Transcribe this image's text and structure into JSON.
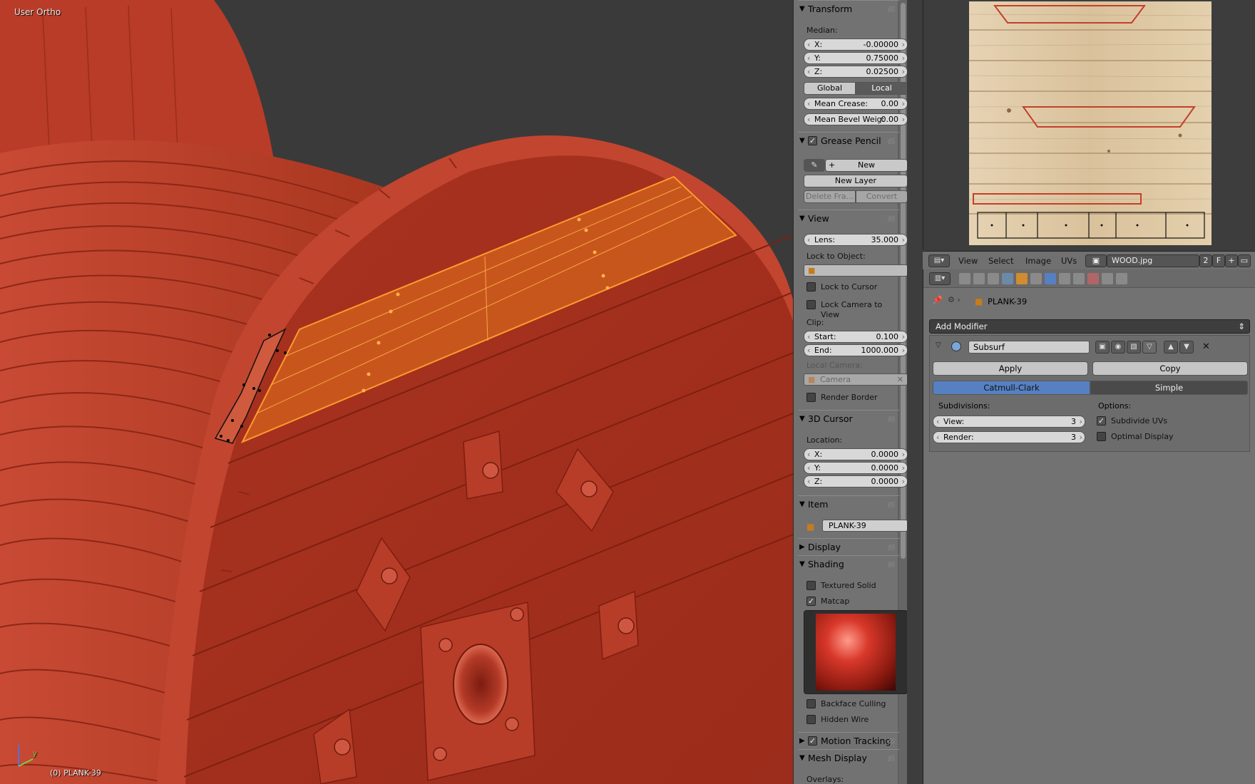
{
  "viewport": {
    "view_label": "User Ortho",
    "object_label": "(0) PLANK-39",
    "axis_label_y": "y"
  },
  "npanel": {
    "transform": {
      "title": "Transform",
      "median_label": "Median:",
      "x_label": "X:",
      "x_value": "-0.00000",
      "y_label": "Y:",
      "y_value": "0.75000",
      "z_label": "Z:",
      "z_value": "0.02500",
      "global_label": "Global",
      "local_label": "Local",
      "crease_label": "Mean Crease:",
      "crease_value": "0.00",
      "bevel_label": "Mean Bevel Weig:",
      "bevel_value": "0.00"
    },
    "grease_pencil": {
      "title": "Grease Pencil",
      "new_label": "New",
      "new_layer_label": "New Layer",
      "delete_label": "Delete Fra...",
      "convert_label": "Convert"
    },
    "view": {
      "title": "View",
      "lens_label": "Lens:",
      "lens_value": "35.000",
      "lock_object_label": "Lock to Object:",
      "lock_cursor_label": "Lock to Cursor",
      "lock_camera_label": "Lock Camera to View",
      "clip_label": "Clip:",
      "start_label": "Start:",
      "start_value": "0.100",
      "end_label": "End:",
      "end_value": "1000.000",
      "local_camera_label": "Local Camera:",
      "camera_value": "Camera",
      "render_border_label": "Render Border"
    },
    "cursor": {
      "title": "3D Cursor",
      "location_label": "Location:",
      "x_label": "X:",
      "x_value": "0.0000",
      "y_label": "Y:",
      "y_value": "0.0000",
      "z_label": "Z:",
      "z_value": "0.0000"
    },
    "item": {
      "title": "Item",
      "name_value": "PLANK-39"
    },
    "display": {
      "title": "Display"
    },
    "shading": {
      "title": "Shading",
      "textured_solid_label": "Textured Solid",
      "matcap_label": "Matcap",
      "backface_label": "Backface Culling",
      "hidden_wire_label": "Hidden Wire"
    },
    "motion_tracking": {
      "title": "Motion Tracking"
    },
    "mesh_display": {
      "title": "Mesh Display",
      "overlays_label": "Overlays:"
    }
  },
  "image_editor": {
    "menu": [
      "View",
      "Select",
      "Image",
      "UVs"
    ],
    "image_name": "WOOD.jpg",
    "user_count": "2",
    "fake_user": "F"
  },
  "properties": {
    "object_name": "PLANK-39",
    "add_modifier_label": "Add Modifier",
    "modifier_name": "Subsurf",
    "apply_label": "Apply",
    "copy_label": "Copy",
    "catmull_label": "Catmull-Clark",
    "simple_label": "Simple",
    "subdivisions_label": "Subdivisions:",
    "view_label": "View:",
    "view_value": "3",
    "render_label": "Render:",
    "render_value": "3",
    "options_label": "Options:",
    "subdivide_uvs_label": "Subdivide UVs",
    "optimal_display_label": "Optimal Display"
  },
  "colors": {
    "model_red": "#c2402c",
    "selection_orange": "#e8891e",
    "active_blue": "#5680c2"
  }
}
